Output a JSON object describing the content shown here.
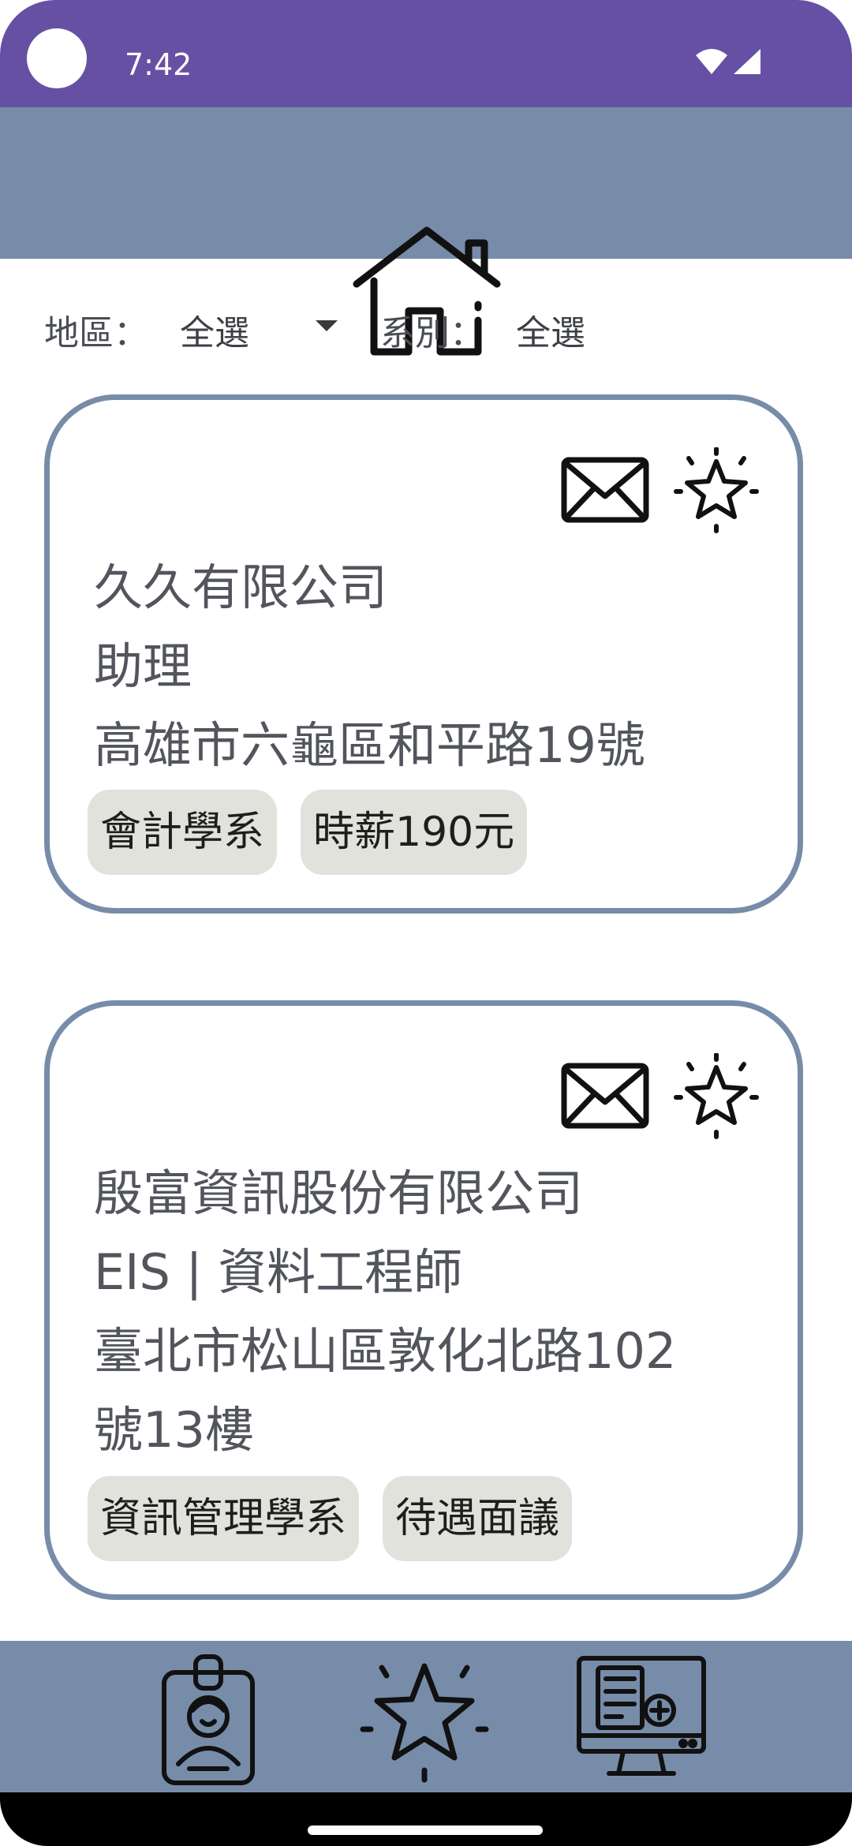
{
  "status_bar": {
    "time": "7:42"
  },
  "header": {
    "icon": "home-icon"
  },
  "filters": {
    "region_label": "地區：",
    "region_value": "全選",
    "department_label": "系別：",
    "department_value": "全選"
  },
  "jobs": [
    {
      "company": "久久有限公司",
      "position": "助理",
      "address": "高雄市六龜區和平路19號",
      "tags": [
        "會計學系",
        "時薪190元"
      ]
    },
    {
      "company": "殷富資訊股份有限公司",
      "position": "EIS | 資料工程師",
      "address_line1": "臺北市松山區敦化北路102",
      "address_line2": "號13樓",
      "tags": [
        "資訊管理學系",
        "待遇面議"
      ]
    }
  ],
  "bottom_nav": {
    "items": [
      "profile-badge-icon",
      "star-icon",
      "computer-resume-icon"
    ]
  },
  "colors": {
    "status_bar": "#6650a4",
    "header": "#778ca9",
    "card_border": "#778ca9",
    "tag_bg": "#e2e2dd"
  }
}
